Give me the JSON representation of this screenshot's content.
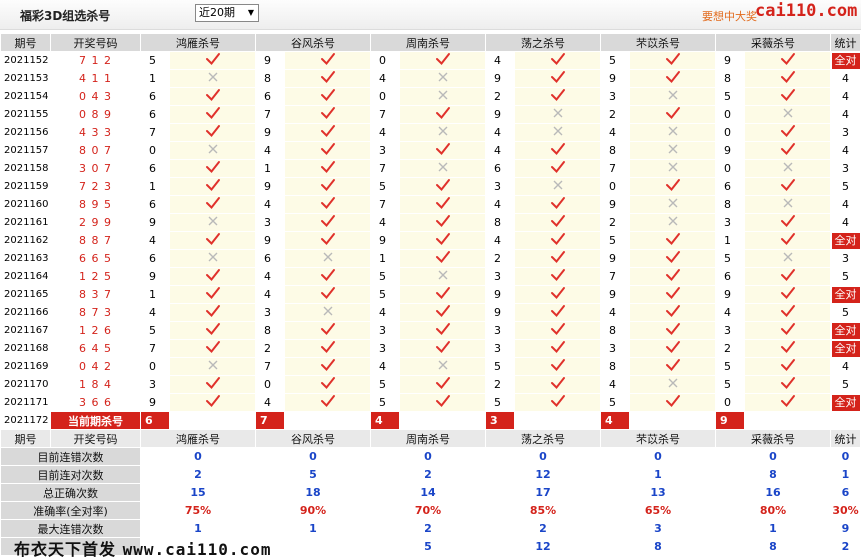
{
  "header": {
    "title": "福彩3D组选杀号",
    "period_select": "近20期",
    "ad_text": "要想中大奖",
    "logo": "cai110.com"
  },
  "columns": {
    "issue": "期号",
    "draw": "开奖号码",
    "experts": [
      "鸿雁杀号",
      "谷风杀号",
      "周南杀号",
      "荡之杀号",
      "芣苡杀号",
      "采薇杀号"
    ],
    "total": "统计"
  },
  "full_label": "全对",
  "rows": [
    {
      "issue": "2021152",
      "draw": "7 1 2",
      "picks": [
        [
          5,
          1
        ],
        [
          9,
          1
        ],
        [
          0,
          1
        ],
        [
          4,
          1
        ],
        [
          5,
          1
        ],
        [
          9,
          1
        ]
      ],
      "total": "全对"
    },
    {
      "issue": "2021153",
      "draw": "4 1 1",
      "picks": [
        [
          1,
          0
        ],
        [
          8,
          1
        ],
        [
          4,
          0
        ],
        [
          9,
          1
        ],
        [
          9,
          1
        ],
        [
          8,
          1
        ]
      ],
      "total": "4"
    },
    {
      "issue": "2021154",
      "draw": "0 4 3",
      "picks": [
        [
          6,
          1
        ],
        [
          6,
          1
        ],
        [
          0,
          0
        ],
        [
          2,
          1
        ],
        [
          3,
          0
        ],
        [
          5,
          1
        ]
      ],
      "total": "4"
    },
    {
      "issue": "2021155",
      "draw": "0 8 9",
      "picks": [
        [
          6,
          1
        ],
        [
          7,
          1
        ],
        [
          7,
          1
        ],
        [
          9,
          0
        ],
        [
          2,
          1
        ],
        [
          0,
          0
        ]
      ],
      "total": "4"
    },
    {
      "issue": "2021156",
      "draw": "4 3 3",
      "picks": [
        [
          7,
          1
        ],
        [
          9,
          1
        ],
        [
          4,
          0
        ],
        [
          4,
          0
        ],
        [
          4,
          0
        ],
        [
          0,
          1
        ]
      ],
      "total": "3"
    },
    {
      "issue": "2021157",
      "draw": "8 0 7",
      "picks": [
        [
          0,
          0
        ],
        [
          4,
          1
        ],
        [
          3,
          1
        ],
        [
          4,
          1
        ],
        [
          8,
          0
        ],
        [
          9,
          1
        ]
      ],
      "total": "4"
    },
    {
      "issue": "2021158",
      "draw": "3 0 7",
      "picks": [
        [
          6,
          1
        ],
        [
          1,
          1
        ],
        [
          7,
          0
        ],
        [
          6,
          1
        ],
        [
          7,
          0
        ],
        [
          0,
          0
        ]
      ],
      "total": "3"
    },
    {
      "issue": "2021159",
      "draw": "7 2 3",
      "picks": [
        [
          1,
          1
        ],
        [
          9,
          1
        ],
        [
          5,
          1
        ],
        [
          3,
          0
        ],
        [
          0,
          1
        ],
        [
          6,
          1
        ]
      ],
      "total": "5"
    },
    {
      "issue": "2021160",
      "draw": "8 9 5",
      "picks": [
        [
          6,
          1
        ],
        [
          4,
          1
        ],
        [
          7,
          1
        ],
        [
          4,
          1
        ],
        [
          9,
          0
        ],
        [
          8,
          0
        ]
      ],
      "total": "4"
    },
    {
      "issue": "2021161",
      "draw": "2 9 9",
      "picks": [
        [
          9,
          0
        ],
        [
          3,
          1
        ],
        [
          4,
          1
        ],
        [
          8,
          1
        ],
        [
          2,
          0
        ],
        [
          3,
          1
        ]
      ],
      "total": "4"
    },
    {
      "issue": "2021162",
      "draw": "8 8 7",
      "picks": [
        [
          4,
          1
        ],
        [
          9,
          1
        ],
        [
          9,
          1
        ],
        [
          4,
          1
        ],
        [
          5,
          1
        ],
        [
          1,
          1
        ]
      ],
      "total": "全对"
    },
    {
      "issue": "2021163",
      "draw": "6 6 5",
      "picks": [
        [
          6,
          0
        ],
        [
          6,
          0
        ],
        [
          1,
          1
        ],
        [
          2,
          1
        ],
        [
          9,
          1
        ],
        [
          5,
          0
        ]
      ],
      "total": "3"
    },
    {
      "issue": "2021164",
      "draw": "1 2 5",
      "picks": [
        [
          9,
          1
        ],
        [
          4,
          1
        ],
        [
          5,
          0
        ],
        [
          3,
          1
        ],
        [
          7,
          1
        ],
        [
          6,
          1
        ]
      ],
      "total": "5"
    },
    {
      "issue": "2021165",
      "draw": "8 3 7",
      "picks": [
        [
          1,
          1
        ],
        [
          4,
          1
        ],
        [
          5,
          1
        ],
        [
          9,
          1
        ],
        [
          9,
          1
        ],
        [
          9,
          1
        ]
      ],
      "total": "全对"
    },
    {
      "issue": "2021166",
      "draw": "8 7 3",
      "picks": [
        [
          4,
          1
        ],
        [
          3,
          0
        ],
        [
          4,
          1
        ],
        [
          9,
          1
        ],
        [
          4,
          1
        ],
        [
          4,
          1
        ]
      ],
      "total": "5"
    },
    {
      "issue": "2021167",
      "draw": "1 2 6",
      "picks": [
        [
          5,
          1
        ],
        [
          8,
          1
        ],
        [
          3,
          1
        ],
        [
          3,
          1
        ],
        [
          8,
          1
        ],
        [
          3,
          1
        ]
      ],
      "total": "全对"
    },
    {
      "issue": "2021168",
      "draw": "6 4 5",
      "picks": [
        [
          7,
          1
        ],
        [
          2,
          1
        ],
        [
          3,
          1
        ],
        [
          3,
          1
        ],
        [
          3,
          1
        ],
        [
          2,
          1
        ]
      ],
      "total": "全对"
    },
    {
      "issue": "2021169",
      "draw": "0 4 2",
      "picks": [
        [
          0,
          0
        ],
        [
          7,
          1
        ],
        [
          4,
          0
        ],
        [
          5,
          1
        ],
        [
          8,
          1
        ],
        [
          5,
          1
        ]
      ],
      "total": "4"
    },
    {
      "issue": "2021170",
      "draw": "1 8 4",
      "picks": [
        [
          3,
          1
        ],
        [
          0,
          1
        ],
        [
          5,
          1
        ],
        [
          2,
          1
        ],
        [
          4,
          0
        ],
        [
          5,
          1
        ]
      ],
      "total": "5"
    },
    {
      "issue": "2021171",
      "draw": "3 6 6",
      "picks": [
        [
          9,
          1
        ],
        [
          4,
          1
        ],
        [
          5,
          1
        ],
        [
          5,
          1
        ],
        [
          5,
          1
        ],
        [
          0,
          1
        ]
      ],
      "total": "全对"
    }
  ],
  "current": {
    "issue": "2021172",
    "label": "当前期杀号",
    "picks": [
      "6",
      "7",
      "4",
      "3",
      "4",
      "9"
    ]
  },
  "stats": [
    {
      "label": "目前连错次数",
      "values": [
        "0",
        "0",
        "0",
        "0",
        "0",
        "0"
      ],
      "total": "0",
      "style": "num"
    },
    {
      "label": "目前连对次数",
      "values": [
        "2",
        "5",
        "2",
        "12",
        "1",
        "8"
      ],
      "total": "1",
      "style": "num"
    },
    {
      "label": "总正确次数",
      "values": [
        "15",
        "18",
        "14",
        "17",
        "13",
        "16"
      ],
      "total": "6",
      "style": "num"
    },
    {
      "label": "准确率(全对率)",
      "values": [
        "75%",
        "90%",
        "70%",
        "85%",
        "65%",
        "80%"
      ],
      "total": "30%",
      "style": "rate"
    },
    {
      "label": "最大连错次数",
      "values": [
        "1",
        "1",
        "2",
        "2",
        "3",
        "1"
      ],
      "total": "9",
      "style": "num"
    },
    {
      "label": "",
      "values": [
        "",
        "",
        "5",
        "12",
        "8",
        "8"
      ],
      "total": "2",
      "style": "num"
    }
  ],
  "footer": {
    "text_cn": "布衣天下首发",
    "text_domain": "www.cai110.com"
  }
}
